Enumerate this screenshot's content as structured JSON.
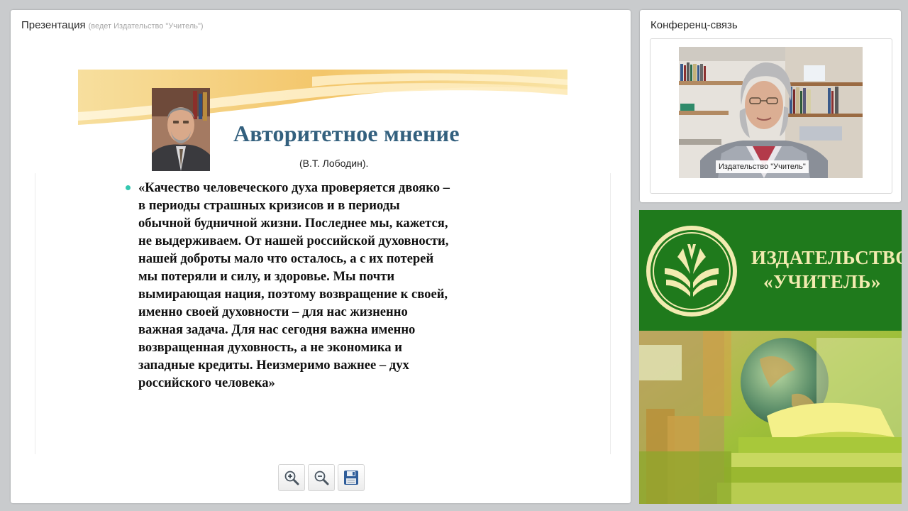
{
  "presentation": {
    "title": "Презентация",
    "subtitle": "(ведет Издательство \"Учитель\")",
    "slide": {
      "heading": "Авторитетное мнение",
      "author": "(В.Т. Лободин).",
      "quote_lines": [
        "«Качество человеческого духа проверяется двояко –",
        "в периоды страшных кризисов и в периоды",
        "обычной будничной жизни. Последнее мы, кажется,",
        "не выдерживаем. От нашей российской духовности,",
        "нашей доброты мало что осталось, а с их потерей",
        "мы потеряли и силу, и здоровье. Мы почти",
        "вымирающая нация, поэтому возвращение к своей,",
        "именно своей духовности – для нас жизненно",
        "важная задача. Для нас сегодня важна именно",
        "возвращенная духовность, а не экономика и",
        "западные кредиты. Неизмеримо важнее – дух",
        "российского человека»"
      ],
      "bullet_color": "#34c7b0",
      "heading_color": "#33607e"
    },
    "toolbar": [
      {
        "icon": "zoom-in-icon"
      },
      {
        "icon": "zoom-out-icon"
      },
      {
        "icon": "save-icon"
      }
    ]
  },
  "conference": {
    "title": "Конференц-связь",
    "caption": "Издательство \"Учитель\""
  },
  "banner": {
    "name_line1": "ИЗДАТЕЛЬСТВО",
    "name_line2": "«УЧИТЕЛЬ»",
    "colors": {
      "green": "#1f7a1c",
      "cream": "#f2ebb0"
    }
  }
}
